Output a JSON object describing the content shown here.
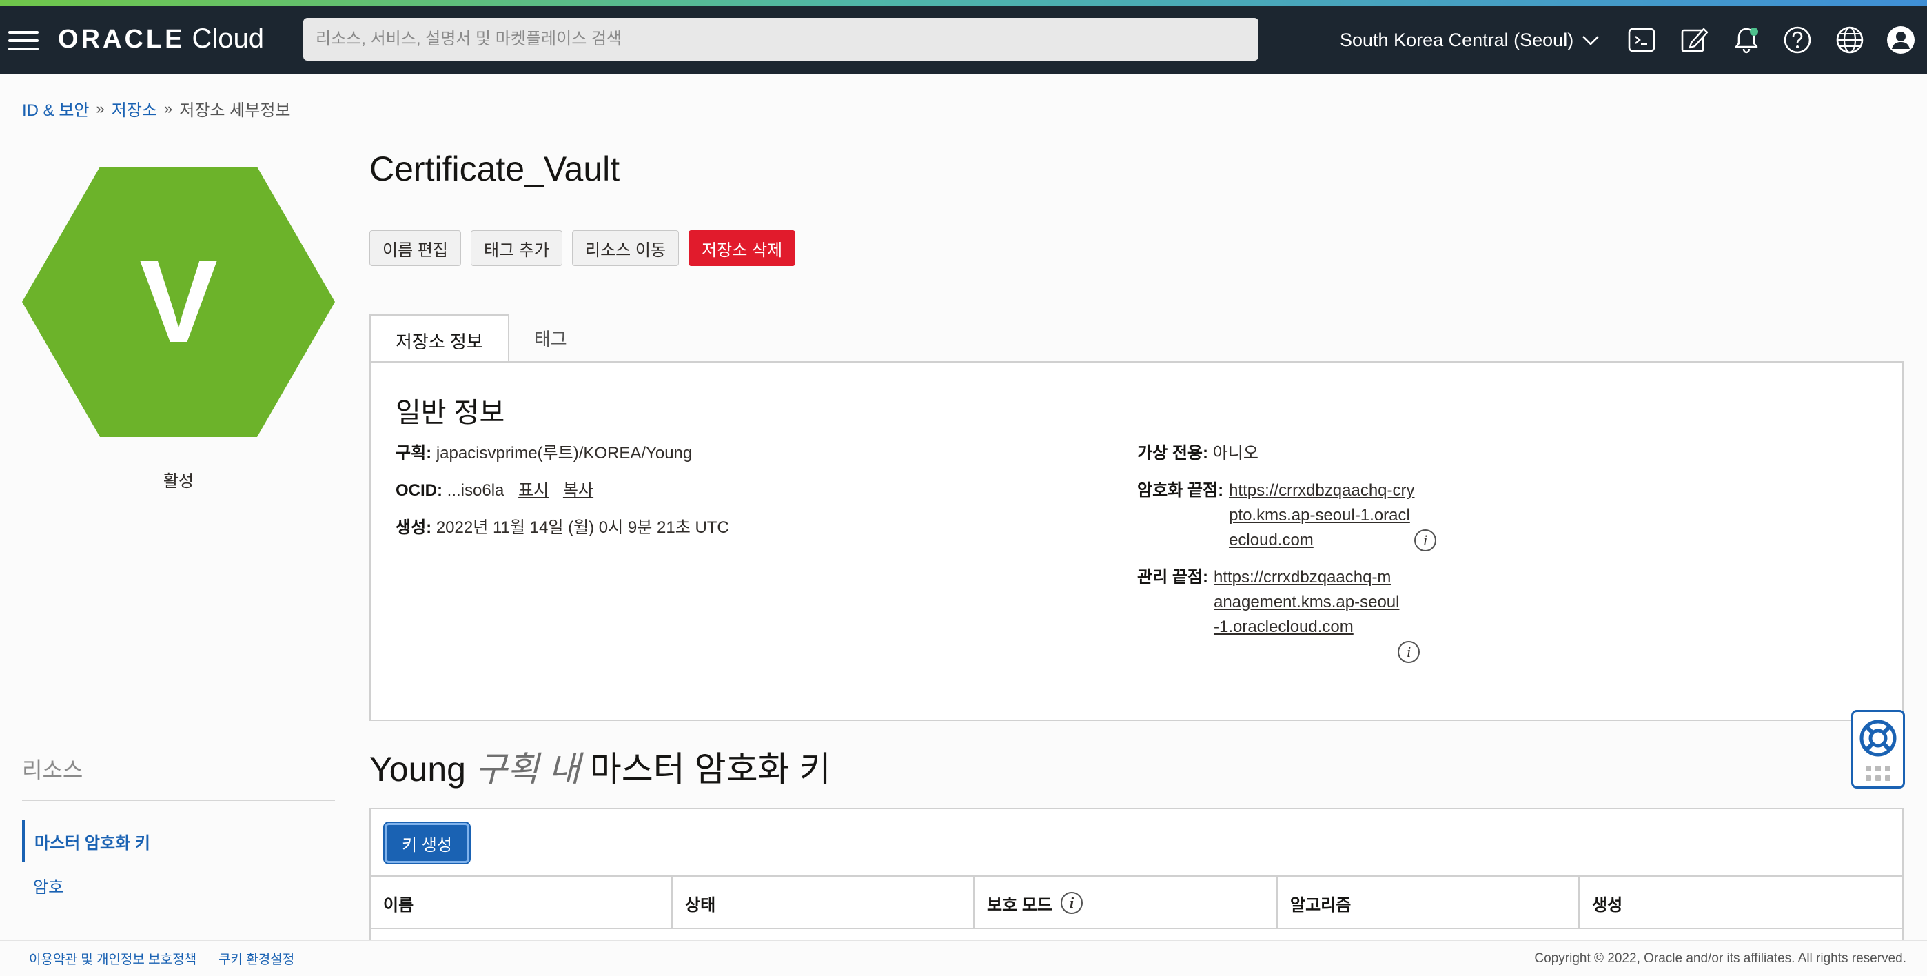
{
  "header": {
    "logo_oracle": "ORACLE",
    "logo_cloud": "Cloud",
    "search_placeholder": "리소스, 서비스, 설명서 및 마켓플레이스 검색",
    "region": "South Korea Central (Seoul)",
    "icons": [
      "menu-icon",
      "cloud-shell-icon",
      "edit-icon",
      "notification-bell-icon",
      "help-icon",
      "language-globe-icon",
      "user-profile-icon"
    ]
  },
  "breadcrumb": {
    "items": [
      "ID & 보안",
      "저장소"
    ],
    "current": "저장소 세부정보",
    "separator": "»"
  },
  "vault_badge": {
    "letter": "V",
    "status": "활성",
    "color": "#6cb32a"
  },
  "sidebar": {
    "title": "리소스",
    "items": [
      {
        "label": "마스터 암호화 키",
        "active": true
      },
      {
        "label": "암호",
        "active": false
      }
    ]
  },
  "page": {
    "title": "Certificate_Vault",
    "actions": {
      "edit_name": "이름 편집",
      "add_tags": "태그 추가",
      "move_resource": "리소스 이동",
      "delete_vault": "저장소 삭제"
    },
    "tabs": [
      "저장소 정보",
      "태그"
    ]
  },
  "vault_info": {
    "section_title": "일반 정보",
    "compartment_label": "구획:",
    "compartment_value": "japacisvprime(루트)/KOREA/Young",
    "ocid_label": "OCID:",
    "ocid_value": "...iso6la",
    "ocid_show": "표시",
    "ocid_copy": "복사",
    "created_label": "생성:",
    "created_value": "2022년 11월 14일 (월) 0시 9분 21초 UTC",
    "virtual_private_label": "가상 전용:",
    "virtual_private_value": "아니오",
    "crypto_endpoint_label": "암호화 끝점:",
    "crypto_endpoint_value": "https://crrxdbzqaachq-crypto.kms.ap-seoul-1.oraclecloud.com",
    "management_endpoint_label": "관리 끝점:",
    "management_endpoint_value": "https://crrxdbzqaachq-management.kms.ap-seoul-1.oraclecloud.com"
  },
  "keys": {
    "title_prefix": "Young",
    "title_compartment": "구획 내",
    "title_suffix": "마스터 암호화 키",
    "create_button": "키 생성",
    "columns": [
      "이름",
      "상태",
      "보호 모드",
      "알고리즘",
      "생성"
    ]
  },
  "footer": {
    "terms": "이용약관 및 개인정보 보호정책",
    "cookies": "쿠키 환경설정",
    "copyright": "Copyright © 2022, Oracle and/or its affiliates. All rights reserved."
  },
  "colors": {
    "header_bg": "#1c2630",
    "link": "#1a62b3",
    "danger": "#e11b2c",
    "primary": "#1a62b3",
    "hex_green": "#6cb32a"
  }
}
